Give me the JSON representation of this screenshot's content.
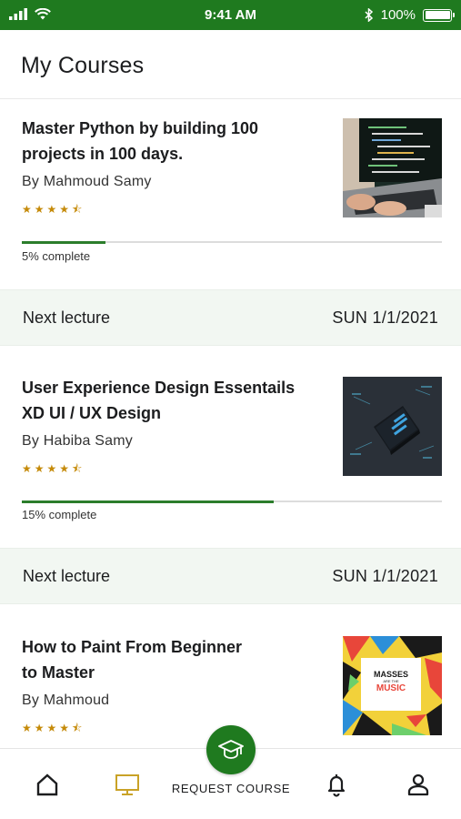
{
  "status_bar": {
    "time": "9:41 AM",
    "battery": "100%"
  },
  "header": {
    "title": "My Courses"
  },
  "courses": [
    {
      "title": "Master Python by building 100 projects in 100 days.",
      "author": "By Mahmoud Samy",
      "rating_stars": "★★★★⯪",
      "progress": 0.05,
      "progress_text": "5% complete",
      "thumbnail": "laptop-code-photo"
    },
    {
      "title": "User Experience Design Essentails XD UI / UX Design",
      "author": "By Habiba Samy",
      "rating_stars": "★★★★⯪",
      "progress": 0.15,
      "progress_text": "15% complete",
      "thumbnail": "phone-ui-illustration"
    },
    {
      "title": "How to Paint From Beginner to Master",
      "author": "By Mahmoud",
      "rating_stars": "★★★★⯪",
      "thumbnail": "masses-music-poster",
      "thumb_text": {
        "line1": "MASSES",
        "line2": "ARE THE",
        "line3": "MUSIC"
      }
    }
  ],
  "lectures": [
    {
      "label": "Next lecture",
      "date": "SUN  1/1/2021"
    },
    {
      "label": "Next lecture",
      "date": "SUN  1/1/2021"
    }
  ],
  "bottom_nav": {
    "request_label": "REQUEST COURSE",
    "icons": [
      "home-icon",
      "my-courses-icon",
      "graduation-cap-icon",
      "bell-icon",
      "profile-icon"
    ]
  },
  "colors": {
    "brand_green": "#1f7a1f",
    "star_gold": "#c58a09",
    "active_tab": "#c9a227",
    "lecture_bg": "#f2f7f2"
  }
}
